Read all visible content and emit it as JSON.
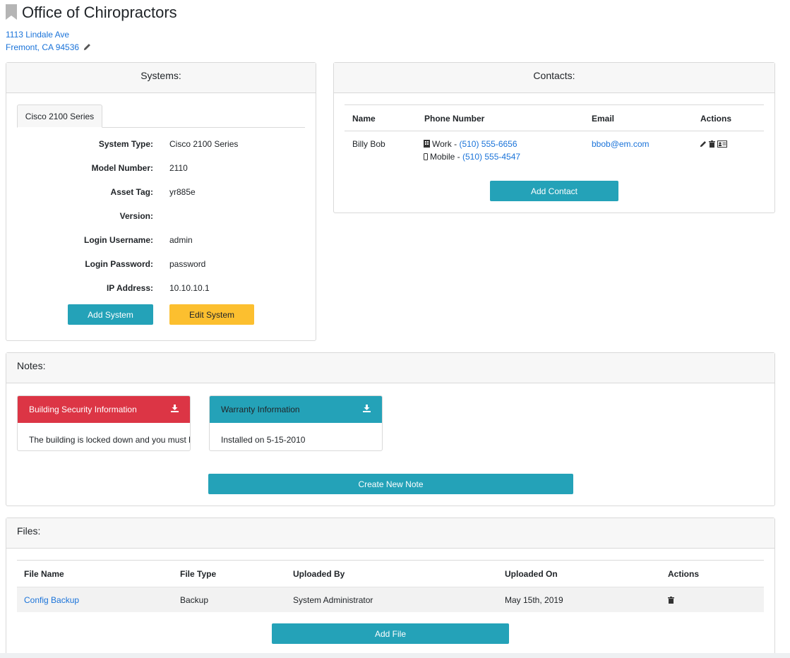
{
  "header": {
    "title": "Office of Chiropractors",
    "address_line1": "1113 Lindale Ave",
    "address_line2": "Fremont, CA  94536"
  },
  "systems": {
    "heading": "Systems:",
    "tab": "Cisco 2100 Series",
    "fields": [
      {
        "label": "System Type:",
        "value": "Cisco 2100 Series"
      },
      {
        "label": "Model Number:",
        "value": "2110"
      },
      {
        "label": "Asset Tag:",
        "value": "yr885e"
      },
      {
        "label": "Version:",
        "value": ""
      },
      {
        "label": "Login Username:",
        "value": "admin"
      },
      {
        "label": "Login Password:",
        "value": "password"
      },
      {
        "label": "IP Address:",
        "value": "10.10.10.1"
      }
    ],
    "add_button": "Add System",
    "edit_button": "Edit System"
  },
  "contacts": {
    "heading": "Contacts:",
    "columns": [
      "Name",
      "Phone Number",
      "Email",
      "Actions"
    ],
    "rows": [
      {
        "name": "Billy Bob",
        "work_label": "Work - ",
        "work_phone": "(510) 555-6656",
        "mobile_label": "Mobile - ",
        "mobile_phone": "(510) 555-4547",
        "email": "bbob@em.com"
      }
    ],
    "add_button": "Add Contact"
  },
  "notes": {
    "heading": "Notes:",
    "items": [
      {
        "title": "Building Security Information",
        "body": "The building is locked down and you must have",
        "color": "#dc3545"
      },
      {
        "title": "Warranty Information",
        "body": "Installed on 5-15-2010",
        "color": "#24a2b8"
      }
    ],
    "create_button": "Create New Note"
  },
  "files": {
    "heading": "Files:",
    "columns": [
      "File Name",
      "File Type",
      "Uploaded By",
      "Uploaded On",
      "Actions"
    ],
    "rows": [
      {
        "name": "Config Backup",
        "type": "Backup",
        "uploaded_by": "System Administrator",
        "uploaded_on": "May 15th, 2019"
      }
    ],
    "add_button": "Add File"
  },
  "colors": {
    "accent": "#24a2b8",
    "warning": "#fcbf2f",
    "danger": "#dc3545",
    "link": "#1a73d9"
  },
  "icons": [
    "bookmark-icon",
    "pencil-icon",
    "building-icon",
    "mobile-icon",
    "trash-icon",
    "id-card-icon",
    "download-icon"
  ]
}
